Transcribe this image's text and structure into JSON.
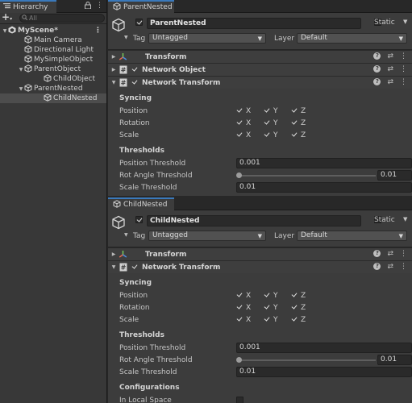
{
  "hierarchy": {
    "tab_label": "Hierarchy",
    "search_placeholder": "All",
    "add_label": "+",
    "scene": {
      "name": "MyScene*"
    },
    "items": [
      {
        "label": "Main Camera"
      },
      {
        "label": "Directional Light"
      },
      {
        "label": "MySimpleObject"
      },
      {
        "label": "ParentObject"
      },
      {
        "label": "ChildObject"
      },
      {
        "label": "ParentNested"
      },
      {
        "label": "ChildNested"
      }
    ]
  },
  "inspector1": {
    "tab_label": "ParentNested",
    "object_name": "ParentNested",
    "static_label": "Static",
    "tag_label": "Tag",
    "tag_value": "Untagged",
    "layer_label": "Layer",
    "layer_value": "Default",
    "components": [
      {
        "title": "Transform"
      },
      {
        "title": "Network Object"
      },
      {
        "title": "Network Transform"
      }
    ],
    "syncing_label": "Syncing",
    "sync_rows": [
      {
        "label": "Position"
      },
      {
        "label": "Rotation"
      },
      {
        "label": "Scale"
      }
    ],
    "axes": [
      "X",
      "Y",
      "Z"
    ],
    "thresholds_label": "Thresholds",
    "position_threshold_label": "Position Threshold",
    "position_threshold_value": "0.001",
    "rot_threshold_label": "Rot Angle Threshold",
    "rot_threshold_value": "0.01",
    "scale_threshold_label": "Scale Threshold",
    "scale_threshold_value": "0.01"
  },
  "inspector2": {
    "tab_label": "ChildNested",
    "object_name": "ChildNested",
    "static_label": "Static",
    "tag_label": "Tag",
    "tag_value": "Untagged",
    "layer_label": "Layer",
    "layer_value": "Default",
    "components": [
      {
        "title": "Transform"
      },
      {
        "title": "Network Transform"
      }
    ],
    "syncing_label": "Syncing",
    "sync_rows": [
      {
        "label": "Position"
      },
      {
        "label": "Rotation"
      },
      {
        "label": "Scale"
      }
    ],
    "axes": [
      "X",
      "Y",
      "Z"
    ],
    "thresholds_label": "Thresholds",
    "position_threshold_label": "Position Threshold",
    "position_threshold_value": "0.001",
    "rot_threshold_label": "Rot Angle Threshold",
    "rot_threshold_value": "0.01",
    "scale_threshold_label": "Scale Threshold",
    "scale_threshold_value": "0.01",
    "configurations_label": "Configurations",
    "in_local_space_label": "In Local Space"
  },
  "colors": {
    "accent": "#3a79bb",
    "panel": "#3c3c3c",
    "field": "#2a2a2a"
  }
}
